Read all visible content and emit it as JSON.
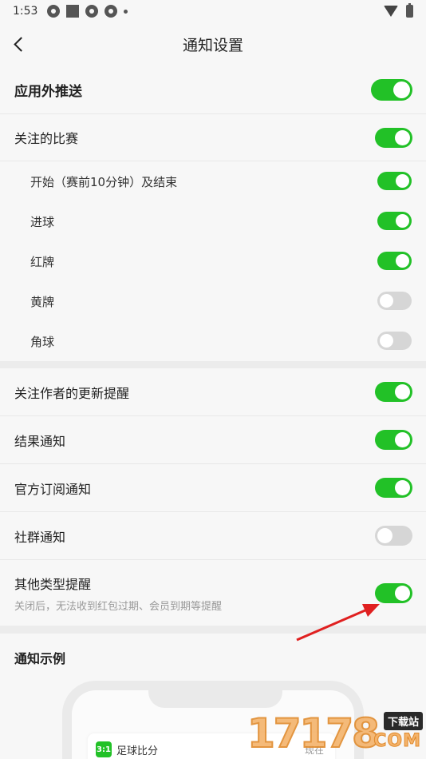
{
  "status_bar": {
    "time": "1:53"
  },
  "header": {
    "title": "通知设置"
  },
  "rows": [
    {
      "label": "应用外推送",
      "on": true
    },
    {
      "label": "关注的比赛",
      "on": true
    },
    {
      "label": "开始（赛前10分钟）及结束",
      "on": true
    },
    {
      "label": "进球",
      "on": true
    },
    {
      "label": "红牌",
      "on": true
    },
    {
      "label": "黄牌",
      "on": false
    },
    {
      "label": "角球",
      "on": false
    },
    {
      "label": "关注作者的更新提醒",
      "on": true
    },
    {
      "label": "结果通知",
      "on": true
    },
    {
      "label": "官方订阅通知",
      "on": true
    },
    {
      "label": "社群通知",
      "on": false
    },
    {
      "label": "其他类型提醒",
      "desc": "关闭后，无法收到红包过期、会员到期等提醒",
      "on": true
    }
  ],
  "example": {
    "title": "通知示例",
    "app_icon_text": "3:1",
    "app_name": "足球比分",
    "time_text": "现在"
  },
  "watermark": {
    "number": "17178",
    "tag": "下载站",
    "domain": "COM"
  },
  "colors": {
    "toggle_on": "#22c127",
    "toggle_off": "#d6d6d6",
    "arrow": "#e02020"
  }
}
